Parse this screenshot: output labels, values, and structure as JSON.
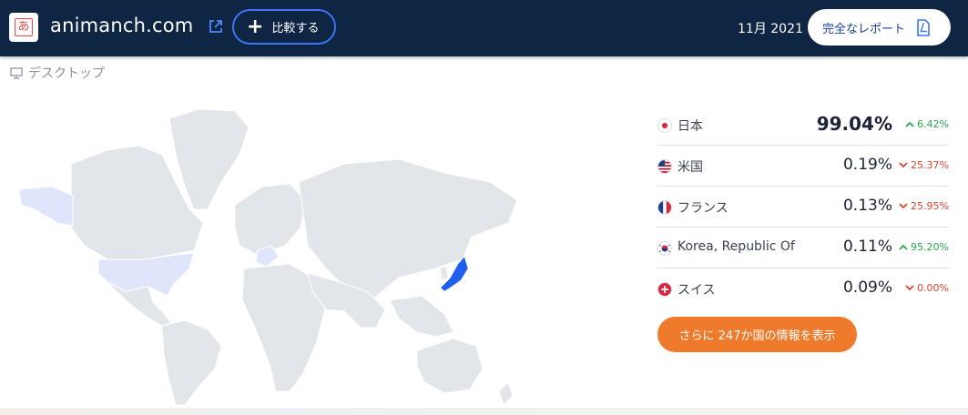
{
  "header": {
    "favicon_char": "あ",
    "domain": "animanch.com",
    "compare_label": "比較する",
    "date": "11月 2021",
    "report_label": "完全なレポート"
  },
  "device": {
    "label": "デスクトップ"
  },
  "countries": [
    {
      "name": "日本",
      "percent": "99.04%",
      "change": "6.42%",
      "direction": "up",
      "flag": "jp"
    },
    {
      "name": "米国",
      "percent": "0.19%",
      "change": "25.37%",
      "direction": "down",
      "flag": "us"
    },
    {
      "name": "フランス",
      "percent": "0.13%",
      "change": "25.95%",
      "direction": "down",
      "flag": "fr"
    },
    {
      "name": "Korea, Republic Of",
      "percent": "0.11%",
      "change": "95.20%",
      "direction": "up",
      "flag": "kr"
    },
    {
      "name": "スイス",
      "percent": "0.09%",
      "change": "0.00%",
      "direction": "down",
      "flag": "ch"
    }
  ],
  "more_button": {
    "label": "さらに 247か国の情報を表示"
  },
  "colors": {
    "header_bg": "#0f2544",
    "accent_blue": "#3c76f5",
    "highlight_japan": "#1f5ff0",
    "light_highlight": "#dfe6fb",
    "orange": "#f07a2b",
    "up": "#2da44e",
    "down": "#e0442f"
  }
}
